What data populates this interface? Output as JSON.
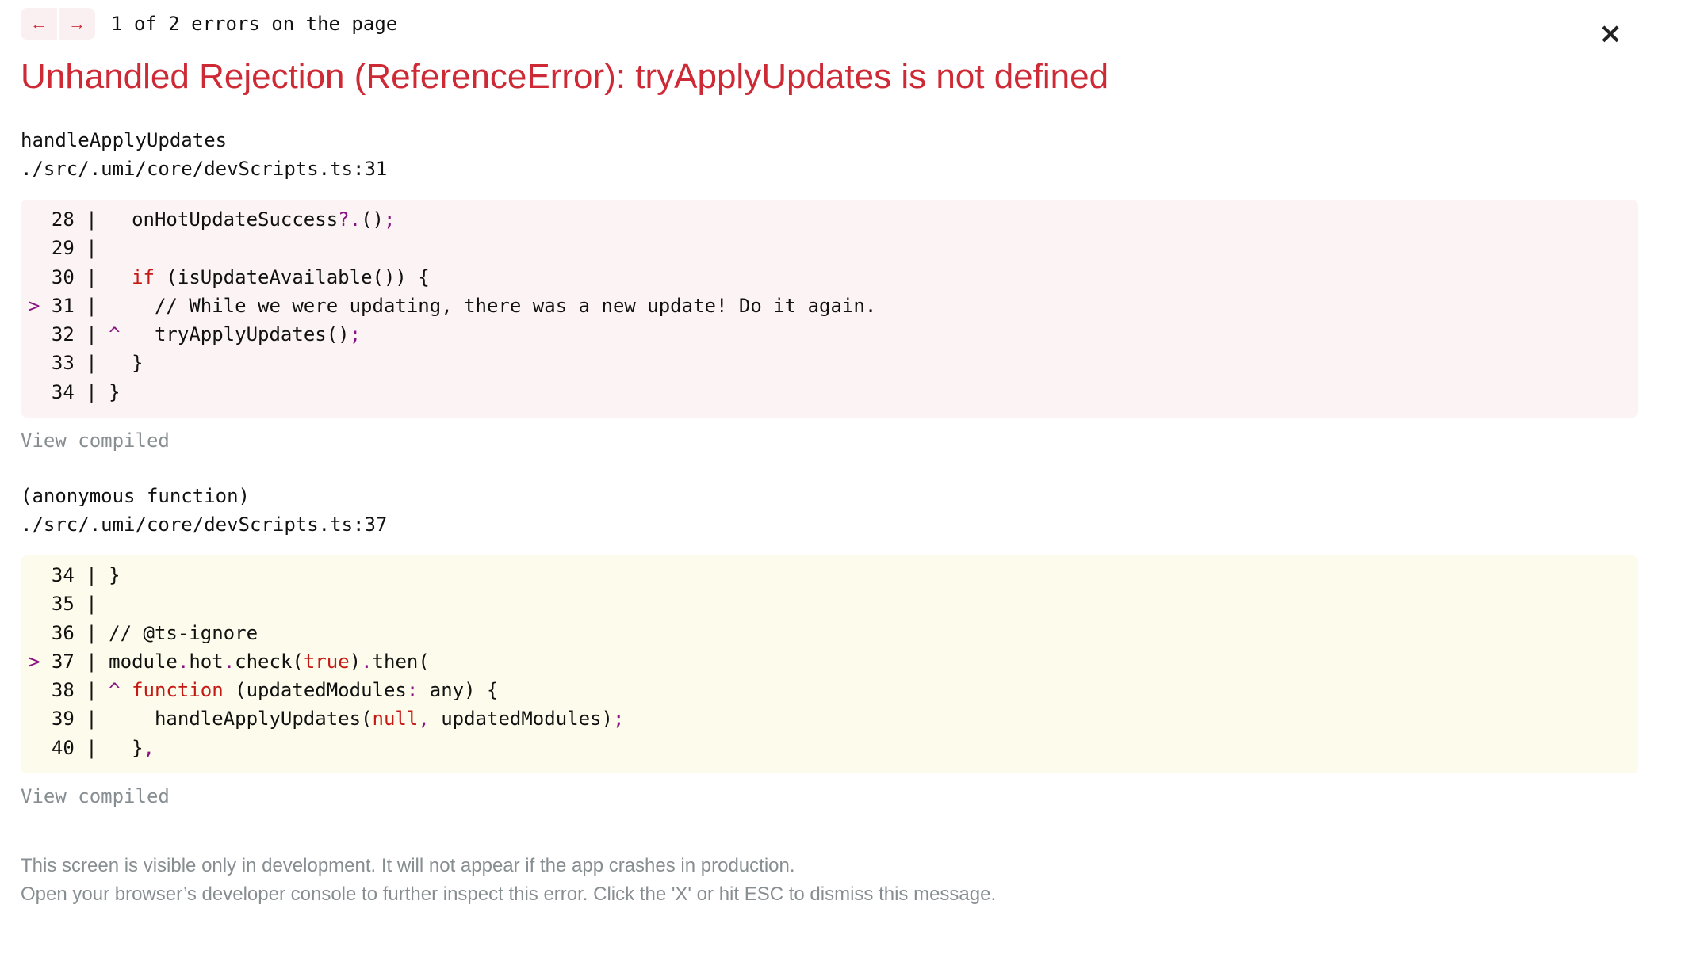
{
  "nav": {
    "prev_icon": "←",
    "next_icon": "→",
    "status": "1 of 2 errors on the page"
  },
  "close_icon": "×",
  "title": "Unhandled Rejection (ReferenceError): tryApplyUpdates is not defined",
  "frames": [
    {
      "function": "handleApplyUpdates",
      "location": "./src/.umi/core/devScripts.ts:31",
      "view_compiled": "View compiled",
      "lines": [
        {
          "n": "28",
          "hl": false,
          "caret": false,
          "segs": [
            [
              "  onHotUpdateSuccess",
              ""
            ],
            [
              "?.",
              "pu"
            ],
            [
              "()",
              ""
            ],
            [
              ";",
              "pu"
            ]
          ]
        },
        {
          "n": "29",
          "hl": false,
          "caret": false,
          "segs": []
        },
        {
          "n": "30",
          "hl": false,
          "caret": false,
          "segs": [
            [
              "  ",
              ""
            ],
            [
              "if",
              "kw"
            ],
            [
              " (isUpdateAvailable()) {",
              ""
            ]
          ]
        },
        {
          "n": "31",
          "hl": true,
          "caret": false,
          "segs": [
            [
              "    // While we were updating, there was a new update! Do it again.",
              ""
            ]
          ]
        },
        {
          "n": "32",
          "hl": false,
          "caret": true,
          "segs": [
            [
              "  tryApplyUpdates()",
              ""
            ],
            [
              ";",
              "pu"
            ]
          ]
        },
        {
          "n": "33",
          "hl": false,
          "caret": false,
          "segs": [
            [
              "  }",
              ""
            ]
          ]
        },
        {
          "n": "34",
          "hl": false,
          "caret": false,
          "segs": [
            [
              "}",
              ""
            ]
          ]
        }
      ]
    },
    {
      "function": "(anonymous function)",
      "location": "./src/.umi/core/devScripts.ts:37",
      "view_compiled": "View compiled",
      "lines": [
        {
          "n": "34",
          "hl": false,
          "caret": false,
          "segs": [
            [
              "}",
              ""
            ]
          ]
        },
        {
          "n": "35",
          "hl": false,
          "caret": false,
          "segs": []
        },
        {
          "n": "36",
          "hl": false,
          "caret": false,
          "segs": [
            [
              "// @ts-ignore",
              ""
            ]
          ]
        },
        {
          "n": "37",
          "hl": true,
          "caret": false,
          "segs": [
            [
              "module",
              ""
            ],
            [
              ".",
              "pu"
            ],
            [
              "hot",
              ""
            ],
            [
              ".",
              "pu"
            ],
            [
              "check(",
              ""
            ],
            [
              "true",
              "kw"
            ],
            [
              ")",
              ""
            ],
            [
              ".",
              "pu"
            ],
            [
              "then(",
              ""
            ]
          ]
        },
        {
          "n": "38",
          "hl": false,
          "caret": true,
          "segs": [
            [
              "function",
              "kw"
            ],
            [
              " (updatedModules",
              ""
            ],
            [
              ":",
              "pu"
            ],
            [
              " any) {",
              ""
            ]
          ]
        },
        {
          "n": "39",
          "hl": false,
          "caret": false,
          "segs": [
            [
              "    handleApplyUpdates(",
              ""
            ],
            [
              "null",
              "kw"
            ],
            [
              ",",
              "pu"
            ],
            [
              " updatedModules)",
              ""
            ],
            [
              ";",
              "pu"
            ]
          ]
        },
        {
          "n": "40",
          "hl": false,
          "caret": false,
          "segs": [
            [
              "  }",
              ""
            ],
            [
              ",",
              "pu"
            ]
          ]
        }
      ]
    }
  ],
  "footer": {
    "line1": "This screen is visible only in development. It will not appear if the app crashes in production.",
    "line2": "Open your browser’s developer console to further inspect this error.  Click the 'X' or hit ESC to dismiss this message."
  }
}
